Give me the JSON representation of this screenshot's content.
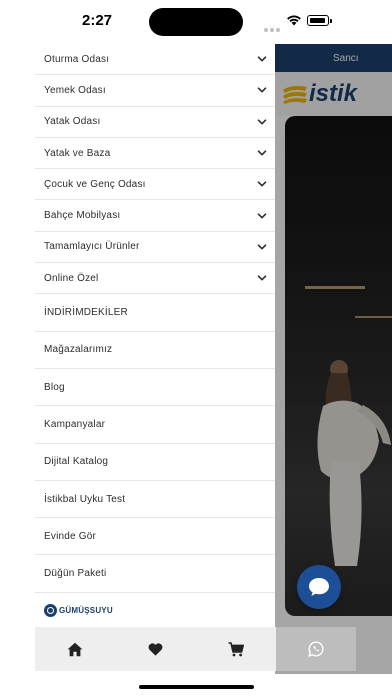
{
  "status_bar": {
    "time": "2:27"
  },
  "background_app": {
    "promo_text": "Sancı",
    "logo_text": "istik",
    "colors": {
      "brand_navy": "#1c3f6e",
      "logo_gold": "#f2b705"
    }
  },
  "menu": {
    "categories": [
      {
        "label": "Oturma Odası",
        "icon": "chevron-down-icon"
      },
      {
        "label": "Yemek Odası",
        "icon": "chevron-down-icon"
      },
      {
        "label": "Yatak Odası",
        "icon": "chevron-down-icon"
      },
      {
        "label": "Yatak ve Baza",
        "icon": "chevron-down-icon"
      },
      {
        "label": "Çocuk ve Genç Odası",
        "icon": "chevron-down-icon"
      },
      {
        "label": "Bahçe Mobilyası",
        "icon": "chevron-down-icon"
      },
      {
        "label": "Tamamlayıcı Ürünler",
        "icon": "chevron-down-icon"
      },
      {
        "label": "Online Özel",
        "icon": "chevron-down-icon"
      }
    ],
    "links": [
      {
        "label": "İNDİRİMDEKİLER"
      },
      {
        "label": "Mağazalarımız"
      },
      {
        "label": "Blog"
      },
      {
        "label": "Kampanyalar"
      },
      {
        "label": "Dijital Katalog"
      },
      {
        "label": "İstikbal Uyku Test"
      },
      {
        "label": "Evinde Gör"
      },
      {
        "label": "Düğün Paketi"
      }
    ],
    "brand": {
      "text": "GÜMÜŞSUYU"
    }
  },
  "bottom_nav": {
    "items": [
      {
        "icon": "home-icon"
      },
      {
        "icon": "heart-icon"
      },
      {
        "icon": "cart-icon"
      },
      {
        "icon": "whatsapp-icon"
      }
    ]
  },
  "chat_button": {
    "icon": "chat-bubble-icon",
    "color": "#1c4f96"
  }
}
